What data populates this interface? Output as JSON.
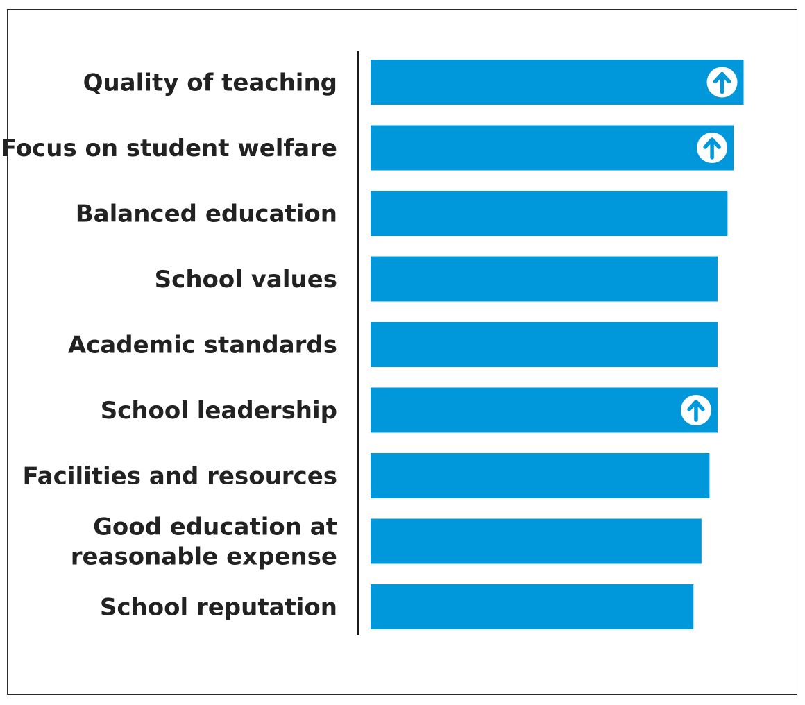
{
  "chart_data": {
    "type": "bar",
    "orientation": "horizontal",
    "title": "",
    "xlabel": "",
    "ylabel": "",
    "xlim": [
      0,
      100
    ],
    "grid": false,
    "legend": "none",
    "categories": [
      "Quality of teaching",
      "Focus on student welfare",
      "Balanced education",
      "School values",
      "Academic standards",
      "School leadership",
      "Facilities and resources",
      "Good education at reasonable expense",
      "School reputation"
    ],
    "category_lines": [
      [
        "Quality of teaching"
      ],
      [
        "Focus on student welfare"
      ],
      [
        "Balanced education"
      ],
      [
        "School values"
      ],
      [
        "Academic standards"
      ],
      [
        "School leadership"
      ],
      [
        "Facilities and resources"
      ],
      [
        "Good education at",
        "reasonable expense"
      ],
      [
        "School reputation"
      ]
    ],
    "values": [
      93,
      90.5,
      89,
      86.5,
      86.5,
      86.5,
      84.5,
      82.5,
      80.5
    ],
    "trend_up": [
      true,
      true,
      false,
      false,
      false,
      true,
      false,
      false,
      false
    ],
    "colors": {
      "bar": "#0098da",
      "axis": "#1a1a1a",
      "label": "#222222",
      "arrow_circle": "#ffffff",
      "arrow": "#0098da"
    },
    "icons": {
      "trend": "up-arrow-icon"
    }
  }
}
